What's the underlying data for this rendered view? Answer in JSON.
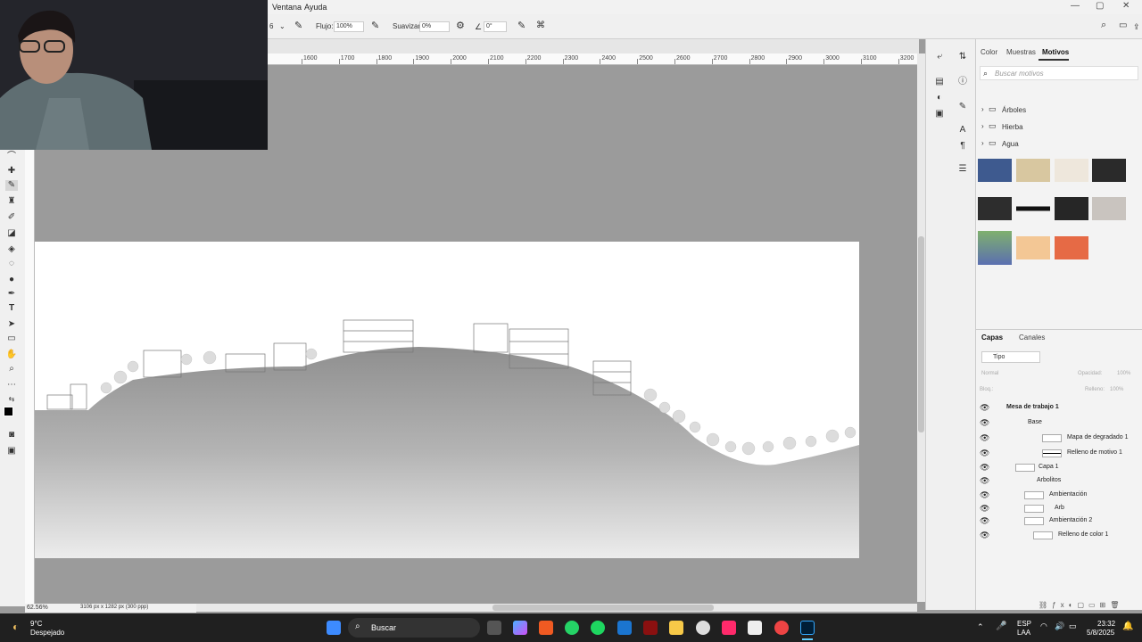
{
  "menubar": {
    "items": [
      "Ventana",
      "Ayuda"
    ]
  },
  "options": {
    "flow_label": "Flujo:",
    "flow_value": "100%",
    "smoothing_label": "Suavizar:",
    "smoothing_value": "0%",
    "angle_value": "0°",
    "brush_size": "6"
  },
  "ruler": {
    "ticks": [
      "1600",
      "1700",
      "1800",
      "1900",
      "2000",
      "2100",
      "2200",
      "2300",
      "2400",
      "2500",
      "2600",
      "2700",
      "2800",
      "2900",
      "3000",
      "3100",
      "3200"
    ]
  },
  "status": {
    "zoom": "62.56%",
    "doc_info": "3106 px x 1282 px (300 ppp)"
  },
  "motivos_panel": {
    "tabs": [
      "Color",
      "Muestras",
      "Motivos"
    ],
    "active_tab": "Motivos",
    "search_placeholder": "Buscar motivos",
    "folders": [
      "Árboles",
      "Hierba",
      "Agua"
    ]
  },
  "layers_panel": {
    "tabs": [
      "Capas",
      "Canales"
    ],
    "filter_label": "Tipo",
    "blend_mode": "Normal",
    "opacity_label": "Opacidad:",
    "opacity_value": "100%",
    "lock_label": "Bloq.:",
    "fill_label": "Relleno:",
    "fill_value": "100%",
    "layers": [
      {
        "name": "Mesa de trabajo 1"
      },
      {
        "name": "Base"
      },
      {
        "name": "Mapa de degradado 1"
      },
      {
        "name": "Relleno de motivo 1"
      },
      {
        "name": "Capa 1"
      },
      {
        "name": "Arbolitos"
      },
      {
        "name": "Ambientación"
      },
      {
        "name": "Arb"
      },
      {
        "name": "Ambientación 2"
      },
      {
        "name": "Relleno de color 1"
      }
    ]
  },
  "taskbar": {
    "weather_temp": "9°C",
    "weather_desc": "Despejado",
    "search_label": "Buscar",
    "lang_line1": "ESP",
    "lang_line2": "LAA",
    "time": "23:32",
    "date": "5/8/2025"
  },
  "colors": {
    "accent": "#1473e6",
    "taskbar": "#202020",
    "canvas_bg": "#9b9b9b"
  }
}
